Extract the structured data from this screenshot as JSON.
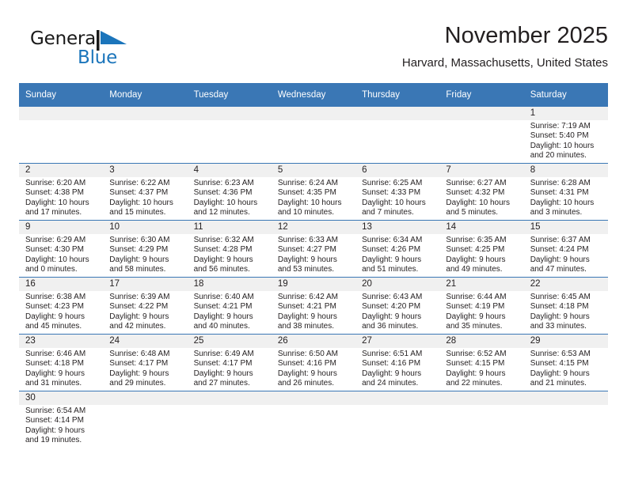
{
  "brand": {
    "name_part1": "General",
    "name_part2": "Blue",
    "flag_icon": "blue-triangle-flag-icon",
    "accent_color": "#1b75bb"
  },
  "header": {
    "title": "November 2025",
    "subtitle": "Harvard, Massachusetts, United States"
  },
  "theme": {
    "header_row_bg": "#3a77b5",
    "daynum_band_bg": "#f0f0f0",
    "row_divider": "#3a77b5",
    "text": "#231f20"
  },
  "calendar": {
    "weekday_headers": [
      "Sunday",
      "Monday",
      "Tuesday",
      "Wednesday",
      "Thursday",
      "Friday",
      "Saturday"
    ],
    "weeks": [
      [
        {
          "day": "",
          "lines": []
        },
        {
          "day": "",
          "lines": []
        },
        {
          "day": "",
          "lines": []
        },
        {
          "day": "",
          "lines": []
        },
        {
          "day": "",
          "lines": []
        },
        {
          "day": "",
          "lines": []
        },
        {
          "day": "1",
          "lines": [
            "Sunrise: 7:19 AM",
            "Sunset: 5:40 PM",
            "Daylight: 10 hours",
            "and 20 minutes."
          ]
        }
      ],
      [
        {
          "day": "2",
          "lines": [
            "Sunrise: 6:20 AM",
            "Sunset: 4:38 PM",
            "Daylight: 10 hours",
            "and 17 minutes."
          ]
        },
        {
          "day": "3",
          "lines": [
            "Sunrise: 6:22 AM",
            "Sunset: 4:37 PM",
            "Daylight: 10 hours",
            "and 15 minutes."
          ]
        },
        {
          "day": "4",
          "lines": [
            "Sunrise: 6:23 AM",
            "Sunset: 4:36 PM",
            "Daylight: 10 hours",
            "and 12 minutes."
          ]
        },
        {
          "day": "5",
          "lines": [
            "Sunrise: 6:24 AM",
            "Sunset: 4:35 PM",
            "Daylight: 10 hours",
            "and 10 minutes."
          ]
        },
        {
          "day": "6",
          "lines": [
            "Sunrise: 6:25 AM",
            "Sunset: 4:33 PM",
            "Daylight: 10 hours",
            "and 7 minutes."
          ]
        },
        {
          "day": "7",
          "lines": [
            "Sunrise: 6:27 AM",
            "Sunset: 4:32 PM",
            "Daylight: 10 hours",
            "and 5 minutes."
          ]
        },
        {
          "day": "8",
          "lines": [
            "Sunrise: 6:28 AM",
            "Sunset: 4:31 PM",
            "Daylight: 10 hours",
            "and 3 minutes."
          ]
        }
      ],
      [
        {
          "day": "9",
          "lines": [
            "Sunrise: 6:29 AM",
            "Sunset: 4:30 PM",
            "Daylight: 10 hours",
            "and 0 minutes."
          ]
        },
        {
          "day": "10",
          "lines": [
            "Sunrise: 6:30 AM",
            "Sunset: 4:29 PM",
            "Daylight: 9 hours",
            "and 58 minutes."
          ]
        },
        {
          "day": "11",
          "lines": [
            "Sunrise: 6:32 AM",
            "Sunset: 4:28 PM",
            "Daylight: 9 hours",
            "and 56 minutes."
          ]
        },
        {
          "day": "12",
          "lines": [
            "Sunrise: 6:33 AM",
            "Sunset: 4:27 PM",
            "Daylight: 9 hours",
            "and 53 minutes."
          ]
        },
        {
          "day": "13",
          "lines": [
            "Sunrise: 6:34 AM",
            "Sunset: 4:26 PM",
            "Daylight: 9 hours",
            "and 51 minutes."
          ]
        },
        {
          "day": "14",
          "lines": [
            "Sunrise: 6:35 AM",
            "Sunset: 4:25 PM",
            "Daylight: 9 hours",
            "and 49 minutes."
          ]
        },
        {
          "day": "15",
          "lines": [
            "Sunrise: 6:37 AM",
            "Sunset: 4:24 PM",
            "Daylight: 9 hours",
            "and 47 minutes."
          ]
        }
      ],
      [
        {
          "day": "16",
          "lines": [
            "Sunrise: 6:38 AM",
            "Sunset: 4:23 PM",
            "Daylight: 9 hours",
            "and 45 minutes."
          ]
        },
        {
          "day": "17",
          "lines": [
            "Sunrise: 6:39 AM",
            "Sunset: 4:22 PM",
            "Daylight: 9 hours",
            "and 42 minutes."
          ]
        },
        {
          "day": "18",
          "lines": [
            "Sunrise: 6:40 AM",
            "Sunset: 4:21 PM",
            "Daylight: 9 hours",
            "and 40 minutes."
          ]
        },
        {
          "day": "19",
          "lines": [
            "Sunrise: 6:42 AM",
            "Sunset: 4:21 PM",
            "Daylight: 9 hours",
            "and 38 minutes."
          ]
        },
        {
          "day": "20",
          "lines": [
            "Sunrise: 6:43 AM",
            "Sunset: 4:20 PM",
            "Daylight: 9 hours",
            "and 36 minutes."
          ]
        },
        {
          "day": "21",
          "lines": [
            "Sunrise: 6:44 AM",
            "Sunset: 4:19 PM",
            "Daylight: 9 hours",
            "and 35 minutes."
          ]
        },
        {
          "day": "22",
          "lines": [
            "Sunrise: 6:45 AM",
            "Sunset: 4:18 PM",
            "Daylight: 9 hours",
            "and 33 minutes."
          ]
        }
      ],
      [
        {
          "day": "23",
          "lines": [
            "Sunrise: 6:46 AM",
            "Sunset: 4:18 PM",
            "Daylight: 9 hours",
            "and 31 minutes."
          ]
        },
        {
          "day": "24",
          "lines": [
            "Sunrise: 6:48 AM",
            "Sunset: 4:17 PM",
            "Daylight: 9 hours",
            "and 29 minutes."
          ]
        },
        {
          "day": "25",
          "lines": [
            "Sunrise: 6:49 AM",
            "Sunset: 4:17 PM",
            "Daylight: 9 hours",
            "and 27 minutes."
          ]
        },
        {
          "day": "26",
          "lines": [
            "Sunrise: 6:50 AM",
            "Sunset: 4:16 PM",
            "Daylight: 9 hours",
            "and 26 minutes."
          ]
        },
        {
          "day": "27",
          "lines": [
            "Sunrise: 6:51 AM",
            "Sunset: 4:16 PM",
            "Daylight: 9 hours",
            "and 24 minutes."
          ]
        },
        {
          "day": "28",
          "lines": [
            "Sunrise: 6:52 AM",
            "Sunset: 4:15 PM",
            "Daylight: 9 hours",
            "and 22 minutes."
          ]
        },
        {
          "day": "29",
          "lines": [
            "Sunrise: 6:53 AM",
            "Sunset: 4:15 PM",
            "Daylight: 9 hours",
            "and 21 minutes."
          ]
        }
      ],
      [
        {
          "day": "30",
          "lines": [
            "Sunrise: 6:54 AM",
            "Sunset: 4:14 PM",
            "Daylight: 9 hours",
            "and 19 minutes."
          ]
        },
        {
          "day": "",
          "lines": []
        },
        {
          "day": "",
          "lines": []
        },
        {
          "day": "",
          "lines": []
        },
        {
          "day": "",
          "lines": []
        },
        {
          "day": "",
          "lines": []
        },
        {
          "day": "",
          "lines": []
        }
      ]
    ]
  }
}
